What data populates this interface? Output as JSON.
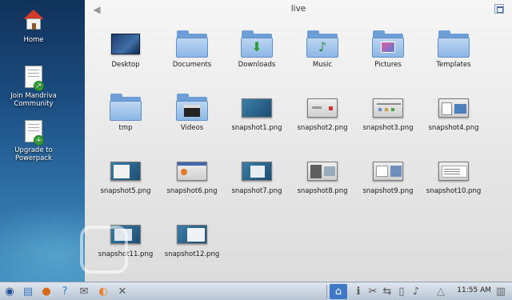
{
  "desktop": {
    "icons": [
      {
        "label": "Home"
      },
      {
        "label": "Join Mandriva Community"
      },
      {
        "label": "Upgrade to Powerpack"
      }
    ]
  },
  "window": {
    "title": "live",
    "items": [
      {
        "label": "Desktop",
        "kind": "desktop"
      },
      {
        "label": "Documents",
        "kind": "folder"
      },
      {
        "label": "Downloads",
        "kind": "folder-download"
      },
      {
        "label": "Music",
        "kind": "folder-music"
      },
      {
        "label": "Pictures",
        "kind": "folder-pictures"
      },
      {
        "label": "Templates",
        "kind": "folder"
      },
      {
        "label": "tmp",
        "kind": "folder"
      },
      {
        "label": "Videos",
        "kind": "folder-videos"
      },
      {
        "label": "snapshot1.png",
        "kind": "image"
      },
      {
        "label": "snapshot2.png",
        "kind": "image"
      },
      {
        "label": "snapshot3.png",
        "kind": "image"
      },
      {
        "label": "snapshot4.png",
        "kind": "image"
      },
      {
        "label": "snapshot5.png",
        "kind": "image"
      },
      {
        "label": "snapshot6.png",
        "kind": "image"
      },
      {
        "label": "snapshot7.png",
        "kind": "image"
      },
      {
        "label": "snapshot8.png",
        "kind": "image"
      },
      {
        "label": "snapshot9.png",
        "kind": "image"
      },
      {
        "label": "snapshot10.png",
        "kind": "image"
      },
      {
        "label": "snapshot11.png",
        "kind": "image"
      },
      {
        "label": "snapshot12.png",
        "kind": "image"
      }
    ]
  },
  "taskbar": {
    "clock": "11:55 AM",
    "launchers": [
      "mandriva-menu-icon",
      "file-manager-icon",
      "firefox-icon",
      "help-icon",
      "mail-icon",
      "media-icon",
      "tools-icon"
    ],
    "tray": [
      "home-icon",
      "info-icon",
      "network-icon",
      "usb-icon",
      "clipboard-icon",
      "volume-icon",
      "update-icon",
      "trash-icon"
    ]
  },
  "colors": {
    "folder": "#8db7e6",
    "desktop_bg": "#1b4c80",
    "window_bg": "#e6e6e6",
    "taskbar": "#c9d3de"
  }
}
